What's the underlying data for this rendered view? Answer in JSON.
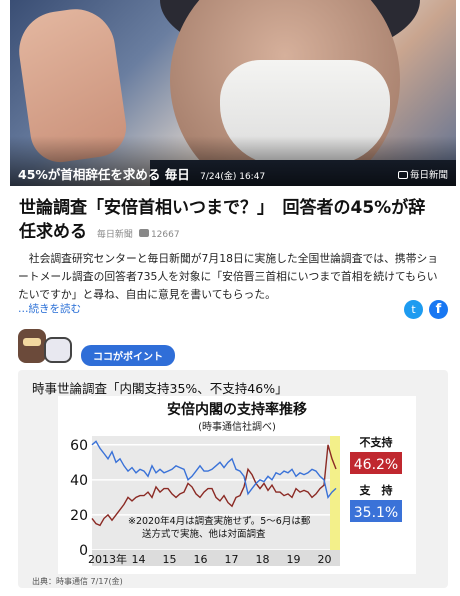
{
  "hero": {
    "caption": "45%が首相辞任を求める 毎日",
    "date": "7/24(金) 16:47",
    "credit": "毎日新聞"
  },
  "article": {
    "title": "世論調査「安倍首相いつまで？」　回答者の45%が辞任求める",
    "source": "毎日新聞",
    "comment_count": "12667",
    "body": "　社会調査研究センターと毎日新聞が7月18日に実施した全国世論調査では、携帯ショートメール調査の回答者735人を対象に「安倍晋三首相にいつまで首相を続けてもらいたいですか」と尋ね、自由に意見を書いてもらった。",
    "more_link": "…続きを読む"
  },
  "share": {
    "twitter_icon": "twitter-icon",
    "facebook_icon": "facebook-icon"
  },
  "point": {
    "label": "ココがポイント"
  },
  "card": {
    "title": "時事世論調査「内閣支持35%、不支持46%」",
    "source": "出典：時事通信 7/17(金)"
  },
  "chart_data": {
    "type": "line",
    "title": "安倍内閣の支持率推移",
    "subtitle": "(時事通信社調べ)",
    "ylim": [
      0,
      65
    ],
    "yticks": [
      0,
      20,
      40,
      60
    ],
    "xticks": [
      "2013年",
      "14",
      "15",
      "16",
      "17",
      "18",
      "19",
      "20"
    ],
    "note": "※2020年4月は調査実施せず。5〜6月は郵送方式で実施、他は対面調査",
    "series": [
      {
        "name": "不支持",
        "label_value": "46.2%",
        "color": "#c0282f",
        "values": [
          18,
          15,
          14,
          18,
          20,
          17,
          20,
          23,
          26,
          30,
          28,
          30,
          31,
          31,
          33,
          30,
          36,
          33,
          35,
          35,
          32,
          30,
          32,
          33,
          38,
          36,
          32,
          30,
          33,
          35,
          35,
          30,
          28,
          31,
          27,
          25,
          30,
          31,
          36,
          46,
          43,
          38,
          35,
          38,
          34,
          37,
          33,
          33,
          31,
          32,
          30,
          35,
          33,
          34,
          33,
          30,
          32,
          35,
          37,
          60,
          52,
          46.2
        ]
      },
      {
        "name": "支　持",
        "label_value": "35.1%",
        "color": "#3a72d8",
        "values": [
          60,
          62,
          58,
          55,
          52,
          56,
          50,
          52,
          48,
          45,
          47,
          44,
          46,
          45,
          42,
          48,
          44,
          46,
          44,
          45,
          46,
          48,
          47,
          46,
          40,
          42,
          45,
          48,
          45,
          45,
          46,
          48,
          50,
          47,
          50,
          52,
          46,
          45,
          42,
          32,
          35,
          38,
          40,
          39,
          42,
          40,
          44,
          43,
          45,
          44,
          46,
          42,
          44,
          43,
          44,
          46,
          45,
          42,
          40,
          30,
          33,
          35.1
        ]
      }
    ]
  }
}
